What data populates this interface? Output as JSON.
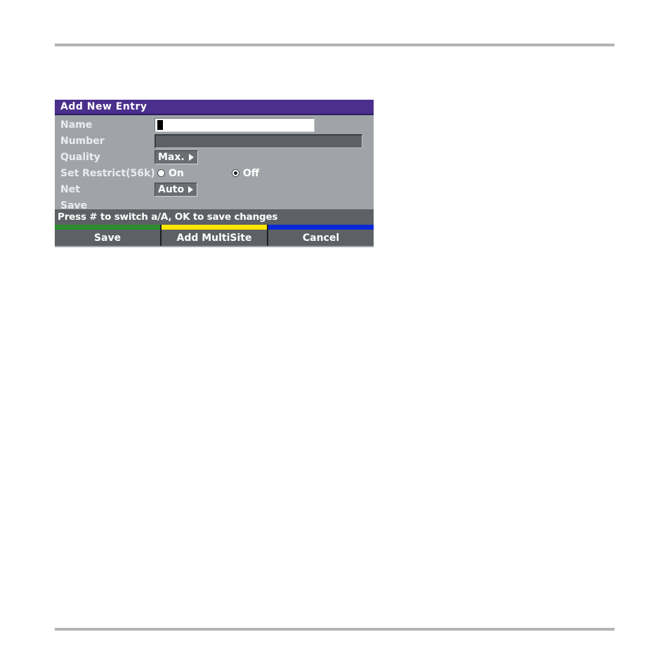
{
  "page": {
    "rule_top": "horizontal-rule",
    "rule_bottom": "horizontal-rule"
  },
  "dialog": {
    "title": "Add New Entry",
    "colors": {
      "titlebar": "#4b2f8c",
      "body": "#a0a4a8",
      "hint_bar": "#5d6165",
      "softkey_green": "#2e8b2e",
      "softkey_yellow": "#ffe600",
      "softkey_blue": "#0a28d8"
    },
    "fields": [
      {
        "label": "Name",
        "type": "text",
        "value": "",
        "placeholder": "",
        "focused": true
      },
      {
        "label": "Number",
        "type": "text",
        "value": "",
        "placeholder": "",
        "focused": false
      },
      {
        "label": "Quality",
        "type": "dropdown",
        "value": "Max.",
        "arrow": "right-triangle-icon"
      },
      {
        "label": "Set Restrict(56k)",
        "type": "radio",
        "options": [
          {
            "label": "On",
            "selected": false
          },
          {
            "label": "Off",
            "selected": true
          }
        ]
      },
      {
        "label": "Net",
        "type": "dropdown",
        "value": "Auto",
        "arrow": "right-triangle-icon"
      },
      {
        "label": "Save",
        "type": "action"
      }
    ],
    "hint": "Press # to switch a/A, OK to save changes",
    "softkeys": [
      {
        "label": "Save",
        "color": "#2e8b2e"
      },
      {
        "label": "Add MultiSite",
        "color": "#ffe600"
      },
      {
        "label": "Cancel",
        "color": "#0a28d8"
      }
    ]
  }
}
